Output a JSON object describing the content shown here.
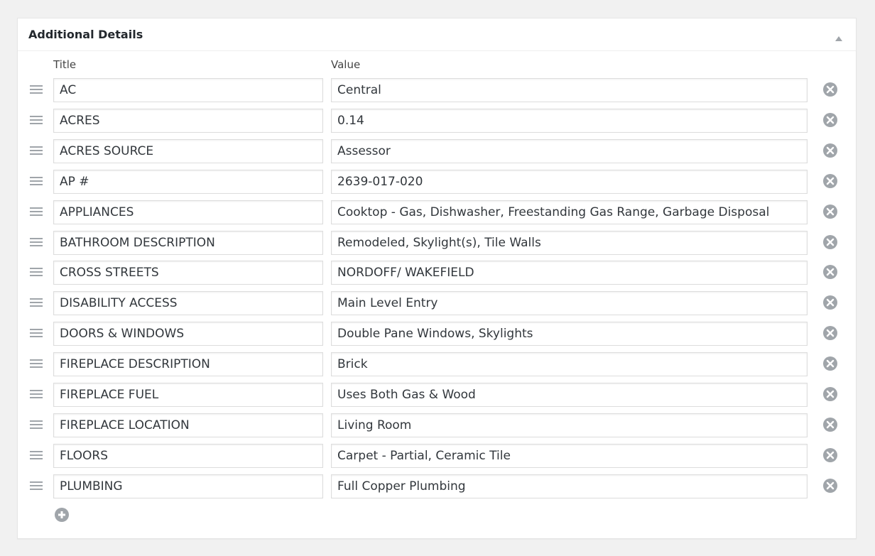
{
  "panel": {
    "title": "Additional Details",
    "columns": {
      "title": "Title",
      "value": "Value"
    }
  },
  "rows": [
    {
      "title": "AC",
      "value": "Central"
    },
    {
      "title": "ACRES",
      "value": "0.14"
    },
    {
      "title": "ACRES SOURCE",
      "value": "Assessor"
    },
    {
      "title": "AP #",
      "value": "2639-017-020"
    },
    {
      "title": "APPLIANCES",
      "value": "Cooktop - Gas, Dishwasher, Freestanding Gas Range, Garbage Disposal"
    },
    {
      "title": "BATHROOM DESCRIPTION",
      "value": "Remodeled, Skylight(s), Tile Walls"
    },
    {
      "title": "CROSS STREETS",
      "value": "NORDOFF/ WAKEFIELD"
    },
    {
      "title": "DISABILITY ACCESS",
      "value": "Main Level Entry"
    },
    {
      "title": "DOORS & WINDOWS",
      "value": "Double Pane Windows, Skylights"
    },
    {
      "title": "FIREPLACE DESCRIPTION",
      "value": "Brick"
    },
    {
      "title": "FIREPLACE FUEL",
      "value": "Uses Both Gas & Wood"
    },
    {
      "title": "FIREPLACE LOCATION",
      "value": "Living Room"
    },
    {
      "title": "FLOORS",
      "value": "Carpet - Partial, Ceramic Tile"
    },
    {
      "title": "PLUMBING",
      "value": "Full Copper Plumbing"
    }
  ],
  "icons": {
    "drag": "drag-handle-icon",
    "remove": "remove-circle-icon",
    "add": "add-circle-icon",
    "collapse": "triangle-up-icon"
  },
  "colors": {
    "icon": "#a0a5aa",
    "border": "#dddddd"
  }
}
